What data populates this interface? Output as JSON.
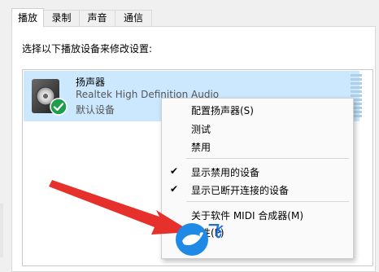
{
  "tabs": [
    {
      "label": "播放",
      "active": true
    },
    {
      "label": "录制",
      "active": false
    },
    {
      "label": "声音",
      "active": false
    },
    {
      "label": "通信",
      "active": false
    }
  ],
  "instruction": "选择以下播放设备来修改设置:",
  "device": {
    "name": "扬声器",
    "description": "Realtek High Definition Audio",
    "status": "默认设备",
    "icon": "speaker-icon",
    "status_icon": "check-badge-icon"
  },
  "context_menu": {
    "items": [
      {
        "label": "配置扬声器(S)",
        "checked": false
      },
      {
        "label": "测试",
        "checked": false
      },
      {
        "label": "禁用",
        "checked": false
      },
      {
        "label": "显示禁用的设备",
        "checked": true
      },
      {
        "label": "显示已断开连接的设备",
        "checked": true
      },
      {
        "label": "关于软件 MIDI 合成器(M)",
        "checked": false
      },
      {
        "label": "属性(P)",
        "checked": false
      }
    ],
    "check_glyph": "✔"
  },
  "colors": {
    "selection": "#cce8ff",
    "arrow": "#e5302c",
    "badge": "#1e9e4a",
    "watermark": "#1e6fd6"
  },
  "watermark": {
    "icon": "bird-logo-icon",
    "text": "飞"
  }
}
